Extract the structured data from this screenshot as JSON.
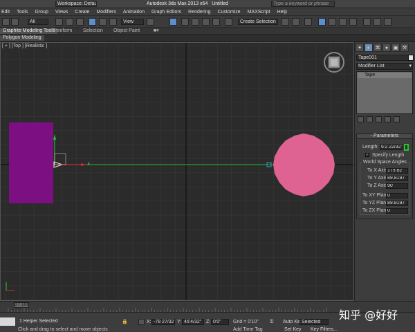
{
  "title_bar": {
    "workspace": "Workspace: Default",
    "app_title": "Autodesk 3ds Max  2013 x64",
    "doc_title": "Untitled",
    "search_placeholder": "Type a keyword or phrase"
  },
  "menu": [
    "Edit",
    "Tools",
    "Group",
    "Views",
    "Create",
    "Modifiers",
    "Animation",
    "Graph Editors",
    "Rendering",
    "Customize",
    "MAXScript",
    "Help"
  ],
  "toolbar": {
    "selection_filter": "All",
    "ref_coord": "View",
    "named_selection": "Create Selection Se"
  },
  "ribbon": {
    "tabs": [
      "Graphite Modeling Tools",
      "Freeform",
      "Selection",
      "Object Paint"
    ],
    "active_tab": 0,
    "sub_label": "Polygon Modeling"
  },
  "viewport": {
    "label": "[ + ] [Top ] [Realistic ]"
  },
  "command_panel": {
    "tab_icons": [
      "create-icon",
      "modify-icon",
      "hierarchy-icon",
      "motion-icon",
      "display-icon",
      "utilities-icon"
    ],
    "object_name": "Tape001",
    "object_color": "#e0e0e0",
    "modifier_list_label": "Modifier List",
    "stack_item": "Tape",
    "rollout_title": "Parameters",
    "length_label": "Length:",
    "length_value": "6'2 22/32\"",
    "specify_length": "Specify Length",
    "angles_group_title": "World Space Angles",
    "angles": [
      {
        "label": "To X Axis:",
        "value": "179.82"
      },
      {
        "label": "To Y Axis:",
        "value": "89.8197"
      },
      {
        "label": "To Z Axis:",
        "value": "90"
      }
    ],
    "planes": [
      {
        "label": "To XY Plane:",
        "value": "0"
      },
      {
        "label": "To YZ Plane:",
        "value": "89.8197"
      },
      {
        "label": "To ZX Plane:",
        "value": "0"
      }
    ]
  },
  "timeline": {
    "frame_label": "0 / 100",
    "ticks": [
      "0",
      "10",
      "15",
      "20",
      "25",
      "30",
      "35",
      "40",
      "45",
      "50",
      "55",
      "60",
      "65",
      "70",
      "75",
      "80",
      "85",
      "90"
    ]
  },
  "status": {
    "selection_info": "1 Helper Selected",
    "prompt": "Click and drag to select and move objects",
    "x_label": "X:",
    "x_value": "-78 27/32\"",
    "y_label": "Y:",
    "y_value": "45'4/32\"",
    "z_label": "Z:",
    "z_value": "0'0\"",
    "grid": "Grid = 0'10\"",
    "add_time_tag": "Add Time Tag",
    "auto_key": "Auto Key",
    "set_key": "Set Key",
    "key_mode": "Selected",
    "key_filters": "Key Filters..."
  },
  "watermark": "知乎 @好好",
  "colors": {
    "purple_box": "#7c0f82",
    "pink_circle": "#de6392",
    "tape_line": "#22c43a",
    "spinner_highlight": "#27c32c"
  }
}
